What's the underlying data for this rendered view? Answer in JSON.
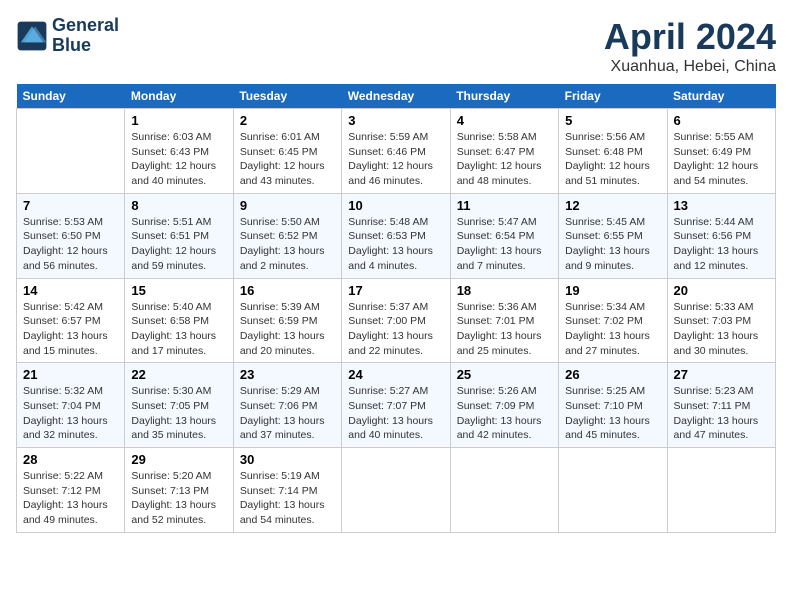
{
  "logo": {
    "line1": "General",
    "line2": "Blue"
  },
  "title": "April 2024",
  "subtitle": "Xuanhua, Hebei, China",
  "weekdays": [
    "Sunday",
    "Monday",
    "Tuesday",
    "Wednesday",
    "Thursday",
    "Friday",
    "Saturday"
  ],
  "weeks": [
    [
      {
        "day": "",
        "sunrise": "",
        "sunset": "",
        "daylight": ""
      },
      {
        "day": "1",
        "sunrise": "Sunrise: 6:03 AM",
        "sunset": "Sunset: 6:43 PM",
        "daylight": "Daylight: 12 hours and 40 minutes."
      },
      {
        "day": "2",
        "sunrise": "Sunrise: 6:01 AM",
        "sunset": "Sunset: 6:45 PM",
        "daylight": "Daylight: 12 hours and 43 minutes."
      },
      {
        "day": "3",
        "sunrise": "Sunrise: 5:59 AM",
        "sunset": "Sunset: 6:46 PM",
        "daylight": "Daylight: 12 hours and 46 minutes."
      },
      {
        "day": "4",
        "sunrise": "Sunrise: 5:58 AM",
        "sunset": "Sunset: 6:47 PM",
        "daylight": "Daylight: 12 hours and 48 minutes."
      },
      {
        "day": "5",
        "sunrise": "Sunrise: 5:56 AM",
        "sunset": "Sunset: 6:48 PM",
        "daylight": "Daylight: 12 hours and 51 minutes."
      },
      {
        "day": "6",
        "sunrise": "Sunrise: 5:55 AM",
        "sunset": "Sunset: 6:49 PM",
        "daylight": "Daylight: 12 hours and 54 minutes."
      }
    ],
    [
      {
        "day": "7",
        "sunrise": "Sunrise: 5:53 AM",
        "sunset": "Sunset: 6:50 PM",
        "daylight": "Daylight: 12 hours and 56 minutes."
      },
      {
        "day": "8",
        "sunrise": "Sunrise: 5:51 AM",
        "sunset": "Sunset: 6:51 PM",
        "daylight": "Daylight: 12 hours and 59 minutes."
      },
      {
        "day": "9",
        "sunrise": "Sunrise: 5:50 AM",
        "sunset": "Sunset: 6:52 PM",
        "daylight": "Daylight: 13 hours and 2 minutes."
      },
      {
        "day": "10",
        "sunrise": "Sunrise: 5:48 AM",
        "sunset": "Sunset: 6:53 PM",
        "daylight": "Daylight: 13 hours and 4 minutes."
      },
      {
        "day": "11",
        "sunrise": "Sunrise: 5:47 AM",
        "sunset": "Sunset: 6:54 PM",
        "daylight": "Daylight: 13 hours and 7 minutes."
      },
      {
        "day": "12",
        "sunrise": "Sunrise: 5:45 AM",
        "sunset": "Sunset: 6:55 PM",
        "daylight": "Daylight: 13 hours and 9 minutes."
      },
      {
        "day": "13",
        "sunrise": "Sunrise: 5:44 AM",
        "sunset": "Sunset: 6:56 PM",
        "daylight": "Daylight: 13 hours and 12 minutes."
      }
    ],
    [
      {
        "day": "14",
        "sunrise": "Sunrise: 5:42 AM",
        "sunset": "Sunset: 6:57 PM",
        "daylight": "Daylight: 13 hours and 15 minutes."
      },
      {
        "day": "15",
        "sunrise": "Sunrise: 5:40 AM",
        "sunset": "Sunset: 6:58 PM",
        "daylight": "Daylight: 13 hours and 17 minutes."
      },
      {
        "day": "16",
        "sunrise": "Sunrise: 5:39 AM",
        "sunset": "Sunset: 6:59 PM",
        "daylight": "Daylight: 13 hours and 20 minutes."
      },
      {
        "day": "17",
        "sunrise": "Sunrise: 5:37 AM",
        "sunset": "Sunset: 7:00 PM",
        "daylight": "Daylight: 13 hours and 22 minutes."
      },
      {
        "day": "18",
        "sunrise": "Sunrise: 5:36 AM",
        "sunset": "Sunset: 7:01 PM",
        "daylight": "Daylight: 13 hours and 25 minutes."
      },
      {
        "day": "19",
        "sunrise": "Sunrise: 5:34 AM",
        "sunset": "Sunset: 7:02 PM",
        "daylight": "Daylight: 13 hours and 27 minutes."
      },
      {
        "day": "20",
        "sunrise": "Sunrise: 5:33 AM",
        "sunset": "Sunset: 7:03 PM",
        "daylight": "Daylight: 13 hours and 30 minutes."
      }
    ],
    [
      {
        "day": "21",
        "sunrise": "Sunrise: 5:32 AM",
        "sunset": "Sunset: 7:04 PM",
        "daylight": "Daylight: 13 hours and 32 minutes."
      },
      {
        "day": "22",
        "sunrise": "Sunrise: 5:30 AM",
        "sunset": "Sunset: 7:05 PM",
        "daylight": "Daylight: 13 hours and 35 minutes."
      },
      {
        "day": "23",
        "sunrise": "Sunrise: 5:29 AM",
        "sunset": "Sunset: 7:06 PM",
        "daylight": "Daylight: 13 hours and 37 minutes."
      },
      {
        "day": "24",
        "sunrise": "Sunrise: 5:27 AM",
        "sunset": "Sunset: 7:07 PM",
        "daylight": "Daylight: 13 hours and 40 minutes."
      },
      {
        "day": "25",
        "sunrise": "Sunrise: 5:26 AM",
        "sunset": "Sunset: 7:09 PM",
        "daylight": "Daylight: 13 hours and 42 minutes."
      },
      {
        "day": "26",
        "sunrise": "Sunrise: 5:25 AM",
        "sunset": "Sunset: 7:10 PM",
        "daylight": "Daylight: 13 hours and 45 minutes."
      },
      {
        "day": "27",
        "sunrise": "Sunrise: 5:23 AM",
        "sunset": "Sunset: 7:11 PM",
        "daylight": "Daylight: 13 hours and 47 minutes."
      }
    ],
    [
      {
        "day": "28",
        "sunrise": "Sunrise: 5:22 AM",
        "sunset": "Sunset: 7:12 PM",
        "daylight": "Daylight: 13 hours and 49 minutes."
      },
      {
        "day": "29",
        "sunrise": "Sunrise: 5:20 AM",
        "sunset": "Sunset: 7:13 PM",
        "daylight": "Daylight: 13 hours and 52 minutes."
      },
      {
        "day": "30",
        "sunrise": "Sunrise: 5:19 AM",
        "sunset": "Sunset: 7:14 PM",
        "daylight": "Daylight: 13 hours and 54 minutes."
      },
      {
        "day": "",
        "sunrise": "",
        "sunset": "",
        "daylight": ""
      },
      {
        "day": "",
        "sunrise": "",
        "sunset": "",
        "daylight": ""
      },
      {
        "day": "",
        "sunrise": "",
        "sunset": "",
        "daylight": ""
      },
      {
        "day": "",
        "sunrise": "",
        "sunset": "",
        "daylight": ""
      }
    ]
  ]
}
